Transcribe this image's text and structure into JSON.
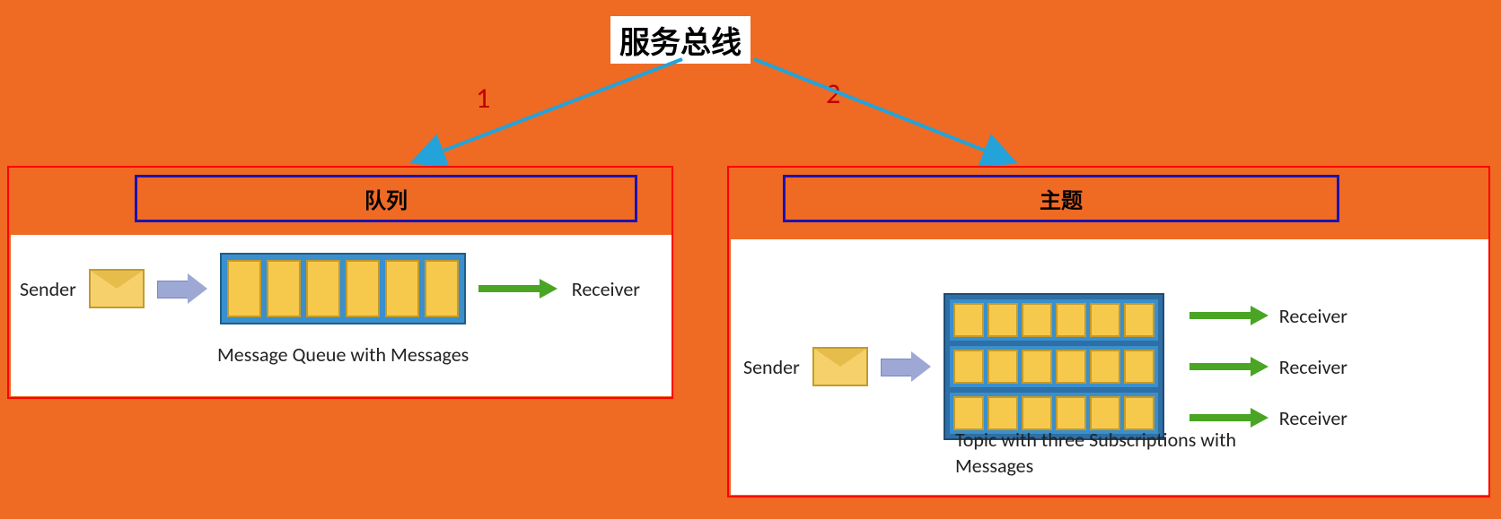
{
  "title": "服务总线",
  "branches": {
    "one": "1",
    "two": "2"
  },
  "left": {
    "heading": "队列",
    "sender": "Sender",
    "receiver": "Receiver",
    "caption": "Message Queue with Messages"
  },
  "right": {
    "heading": "主题",
    "sender": "Sender",
    "receiver": "Receiver",
    "caption": "Topic with three Subscriptions with Messages"
  },
  "colors": {
    "bg": "#ef6a23",
    "panelBorder": "#ff0000",
    "subBorder": "#1a13b3",
    "arrow": "#23a3d9",
    "queue": "#3a8fcc",
    "msg": "#f6c94c",
    "green": "#4aa524"
  }
}
